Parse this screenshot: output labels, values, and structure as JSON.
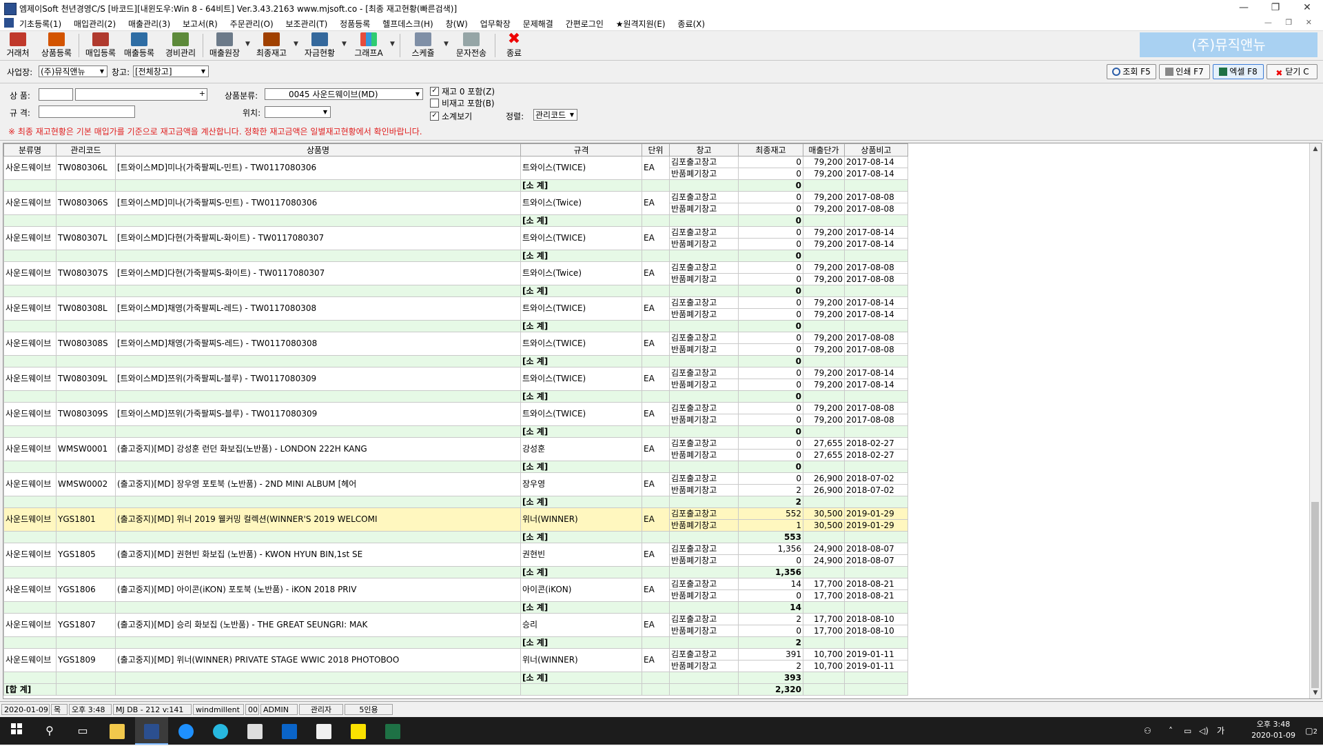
{
  "window": {
    "title": "엠제이Soft 천년경영C/S [바코드][내윈도우:Win 8 - 64비트] Ver.3.43.2163          www.mjsoft.co - [최종 재고현황(빠른검색)]",
    "minimize": "—",
    "maximize": "❐",
    "close": "✕"
  },
  "menu": {
    "items": [
      "기초등록(1)",
      "매입관리(2)",
      "매출관리(3)",
      "보고서(R)",
      "주문관리(O)",
      "보조관리(T)",
      "정품등록",
      "헬프데스크(H)",
      "창(W)",
      "업무확장",
      "문제해결",
      "간편로그인",
      "★원격지원(E)",
      "종료(X)"
    ],
    "mdi_controls": "— ❐ ✕"
  },
  "toolbar": {
    "buttons": [
      "거래처",
      "상품등록",
      "매입등록",
      "매출등록",
      "경비관리",
      "매출원장",
      "최종재고",
      "자금현황",
      "그래프A",
      "스케쥴",
      "문자전송",
      "종료"
    ],
    "company": "(주)뮤직앤뉴"
  },
  "filter": {
    "biz_label": "사업장:",
    "biz_value": "(주)뮤직앤뉴",
    "wh_label": "창고:",
    "wh_value": "[전체창고]",
    "btn_search": "조회 F5",
    "btn_print": "인쇄 F7",
    "btn_excel": "엑셀 F8",
    "btn_close": "닫기 C"
  },
  "search": {
    "product_label": "상  품:",
    "spec_label": "규  격:",
    "category_label": "상품분류:",
    "category_value": "0045 사운드웨이브(MD)",
    "location_label": "위치:",
    "opt_zero": "재고 0 포함(Z)",
    "opt_nonstock": "비재고 포함(B)",
    "opt_subtotal": "소계보기",
    "sort_label": "정렬:",
    "sort_value": "관리코드",
    "notice": "※ 최종 재고현황은 기본 매입가를 기준으로 재고금액을 계산합니다. 정확한 재고금액은 일별재고현황에서 확인바랍니다."
  },
  "grid": {
    "columns": [
      "분류명",
      "관리코드",
      "상품명",
      "규격",
      "단위",
      "창고",
      "최종재고",
      "매출단가",
      "상품비고"
    ],
    "subtotal_label": "[소 계]",
    "total_label": "[합 계]",
    "total_qty": "2,320",
    "groups": [
      {
        "cat": "사운드웨이브",
        "code": "TW080306L",
        "name": "[트와이스MD]미나(가죽팔찌L-민트) - TW0117080306",
        "spec": "트와이스(TWICE)",
        "unit": "EA",
        "rows": [
          {
            "wh": "김포출고창고",
            "qty": "0",
            "price": "79,200",
            "note": "2017-08-14"
          },
          {
            "wh": "반품폐기창고",
            "qty": "0",
            "price": "79,200",
            "note": "2017-08-14"
          }
        ],
        "sub": "0"
      },
      {
        "cat": "사운드웨이브",
        "code": "TW080306S",
        "name": "[트와이스MD]미나(가죽팔찌S-민트) - TW0117080306",
        "spec": "트와이스(Twice)",
        "unit": "EA",
        "rows": [
          {
            "wh": "김포출고창고",
            "qty": "0",
            "price": "79,200",
            "note": "2017-08-08"
          },
          {
            "wh": "반품폐기창고",
            "qty": "0",
            "price": "79,200",
            "note": "2017-08-08"
          }
        ],
        "sub": "0"
      },
      {
        "cat": "사운드웨이브",
        "code": "TW080307L",
        "name": "[트와이스MD]다현(가죽팔찌L-화이트) - TW0117080307",
        "spec": "트와이스(TWICE)",
        "unit": "EA",
        "rows": [
          {
            "wh": "김포출고창고",
            "qty": "0",
            "price": "79,200",
            "note": "2017-08-14"
          },
          {
            "wh": "반품폐기창고",
            "qty": "0",
            "price": "79,200",
            "note": "2017-08-14"
          }
        ],
        "sub": "0"
      },
      {
        "cat": "사운드웨이브",
        "code": "TW080307S",
        "name": "[트와이스MD]다현(가죽팔찌S-화이트) - TW0117080307",
        "spec": "트와이스(Twice)",
        "unit": "EA",
        "rows": [
          {
            "wh": "김포출고창고",
            "qty": "0",
            "price": "79,200",
            "note": "2017-08-08"
          },
          {
            "wh": "반품폐기창고",
            "qty": "0",
            "price": "79,200",
            "note": "2017-08-08"
          }
        ],
        "sub": "0"
      },
      {
        "cat": "사운드웨이브",
        "code": "TW080308L",
        "name": "[트와이스MD]채영(가죽팔찌L-레드) - TW0117080308",
        "spec": "트와이스(TWICE)",
        "unit": "EA",
        "rows": [
          {
            "wh": "김포출고창고",
            "qty": "0",
            "price": "79,200",
            "note": "2017-08-14"
          },
          {
            "wh": "반품폐기창고",
            "qty": "0",
            "price": "79,200",
            "note": "2017-08-14"
          }
        ],
        "sub": "0"
      },
      {
        "cat": "사운드웨이브",
        "code": "TW080308S",
        "name": "[트와이스MD]채영(가죽팔찌S-레드) - TW0117080308",
        "spec": "트와이스(TWICE)",
        "unit": "EA",
        "rows": [
          {
            "wh": "김포출고창고",
            "qty": "0",
            "price": "79,200",
            "note": "2017-08-08"
          },
          {
            "wh": "반품폐기창고",
            "qty": "0",
            "price": "79,200",
            "note": "2017-08-08"
          }
        ],
        "sub": "0"
      },
      {
        "cat": "사운드웨이브",
        "code": "TW080309L",
        "name": "[트와이스MD]쯔위(가죽팔찌L-블루) - TW0117080309",
        "spec": "트와이스(TWICE)",
        "unit": "EA",
        "rows": [
          {
            "wh": "김포출고창고",
            "qty": "0",
            "price": "79,200",
            "note": "2017-08-14"
          },
          {
            "wh": "반품폐기창고",
            "qty": "0",
            "price": "79,200",
            "note": "2017-08-14"
          }
        ],
        "sub": "0"
      },
      {
        "cat": "사운드웨이브",
        "code": "TW080309S",
        "name": "[트와이스MD]쯔위(가죽팔찌S-블루) - TW0117080309",
        "spec": "트와이스(TWICE)",
        "unit": "EA",
        "rows": [
          {
            "wh": "김포출고창고",
            "qty": "0",
            "price": "79,200",
            "note": "2017-08-08"
          },
          {
            "wh": "반품폐기창고",
            "qty": "0",
            "price": "79,200",
            "note": "2017-08-08"
          }
        ],
        "sub": "0"
      },
      {
        "cat": "사운드웨이브",
        "code": "WMSW0001",
        "name": "(출고중지)[MD] 강성훈 런던 화보집(노반품) - LONDON 222H KANG",
        "spec": "강성훈",
        "unit": "EA",
        "rows": [
          {
            "wh": "김포출고창고",
            "qty": "0",
            "price": "27,655",
            "note": "2018-02-27"
          },
          {
            "wh": "반품폐기창고",
            "qty": "0",
            "price": "27,655",
            "note": "2018-02-27"
          }
        ],
        "sub": "0"
      },
      {
        "cat": "사운드웨이브",
        "code": "WMSW0002",
        "name": "(출고중지)[MD] 장우영 포토북 (노반품) - 2ND MINI ALBUM [헤어",
        "spec": "장우영",
        "unit": "EA",
        "rows": [
          {
            "wh": "김포출고창고",
            "qty": "0",
            "price": "26,900",
            "note": "2018-07-02"
          },
          {
            "wh": "반품폐기창고",
            "qty": "2",
            "price": "26,900",
            "note": "2018-07-02"
          }
        ],
        "sub": "2"
      },
      {
        "cat": "사운드웨이브",
        "code": "YGS1801",
        "name": "(출고중지)[MD] 위너 2019 웰커밍 컬렉션(WINNER'S 2019 WELCOMI",
        "spec": "위너(WINNER)",
        "unit": "EA",
        "highlight": true,
        "rows": [
          {
            "wh": "김포출고창고",
            "qty": "552",
            "price": "30,500",
            "note": "2019-01-29"
          },
          {
            "wh": "반품폐기창고",
            "qty": "1",
            "price": "30,500",
            "note": "2019-01-29"
          }
        ],
        "sub": "553"
      },
      {
        "cat": "사운드웨이브",
        "code": "YGS1805",
        "name": "(출고중지)[MD] 권현빈 화보집 (노반품) - KWON HYUN BIN,1st SE",
        "spec": "권현빈",
        "unit": "EA",
        "rows": [
          {
            "wh": "김포출고창고",
            "qty": "1,356",
            "price": "24,900",
            "note": "2018-08-07"
          },
          {
            "wh": "반품폐기창고",
            "qty": "0",
            "price": "24,900",
            "note": "2018-08-07"
          }
        ],
        "sub": "1,356"
      },
      {
        "cat": "사운드웨이브",
        "code": "YGS1806",
        "name": "(출고중지)[MD] 아이콘(iKON) 포토북 (노반품) - iKON 2018 PRIV",
        "spec": "아이콘(iKON)",
        "unit": "EA",
        "rows": [
          {
            "wh": "김포출고창고",
            "qty": "14",
            "price": "17,700",
            "note": "2018-08-21"
          },
          {
            "wh": "반품폐기창고",
            "qty": "0",
            "price": "17,700",
            "note": "2018-08-21"
          }
        ],
        "sub": "14"
      },
      {
        "cat": "사운드웨이브",
        "code": "YGS1807",
        "name": "(출고중지)[MD] 승리 화보집 (노반품) - THE GREAT SEUNGRI: MAK",
        "spec": "승리",
        "unit": "EA",
        "rows": [
          {
            "wh": "김포출고창고",
            "qty": "2",
            "price": "17,700",
            "note": "2018-08-10"
          },
          {
            "wh": "반품폐기창고",
            "qty": "0",
            "price": "17,700",
            "note": "2018-08-10"
          }
        ],
        "sub": "2"
      },
      {
        "cat": "사운드웨이브",
        "code": "YGS1809",
        "name": "(출고중지)[MD] 위너(WINNER) PRIVATE STAGE WWIC 2018 PHOTOBOO",
        "spec": "위너(WINNER)",
        "unit": "EA",
        "rows": [
          {
            "wh": "김포출고창고",
            "qty": "391",
            "price": "10,700",
            "note": "2019-01-11"
          },
          {
            "wh": "반품폐기창고",
            "qty": "2",
            "price": "10,700",
            "note": "2019-01-11"
          }
        ],
        "sub": "393"
      }
    ]
  },
  "status": {
    "date": "2020-01-09",
    "weekday": "목",
    "time": "오후 3:48",
    "db": "MJ DB - 212 v:141",
    "user": "windmillent",
    "code": "00",
    "role": "ADMIN",
    "level": "관리자",
    "license": "5인용"
  },
  "taskbar": {
    "clock_time": "오후 3:48",
    "clock_date": "2020-01-09",
    "ime": "가",
    "notify_count": "2"
  }
}
